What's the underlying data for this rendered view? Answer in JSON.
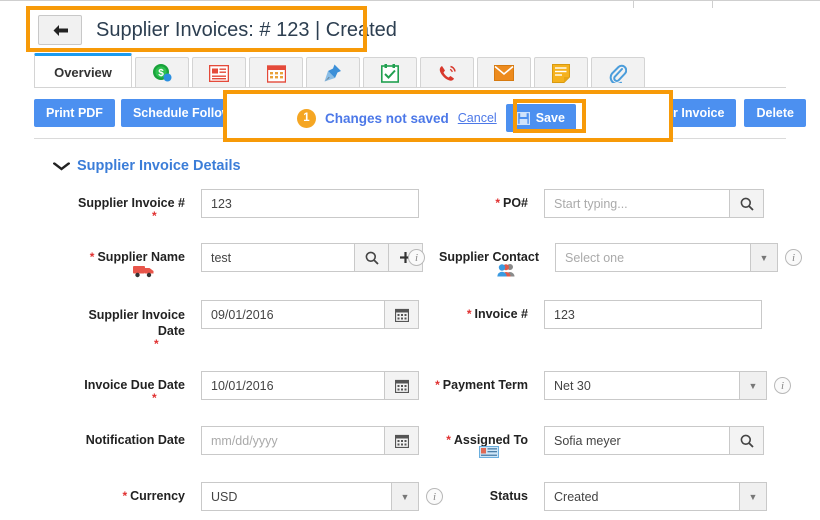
{
  "header": {
    "back_icon": "back-arrow-icon",
    "title": "Supplier Invoices: # 123 | Created"
  },
  "tabs": [
    {
      "label": "Overview",
      "icon": "overview-tab",
      "active": true
    },
    {
      "label": "",
      "icon": "money-dollar-icon",
      "active": false
    },
    {
      "label": "",
      "icon": "invoice-lines-icon",
      "active": false
    },
    {
      "label": "",
      "icon": "calendar-red-icon",
      "active": false
    },
    {
      "label": "",
      "icon": "pin-icon",
      "active": false
    },
    {
      "label": "",
      "icon": "task-check-icon",
      "active": false
    },
    {
      "label": "",
      "icon": "phone-call-icon",
      "active": false
    },
    {
      "label": "",
      "icon": "email-envelope-icon",
      "active": false
    },
    {
      "label": "",
      "icon": "notes-icon",
      "active": false
    },
    {
      "label": "",
      "icon": "attachment-paperclip-icon",
      "active": false
    }
  ],
  "toolbar": {
    "print_pdf": "Print PDF",
    "schedule_follow": "Schedule Follow",
    "invoice": "r Invoice",
    "delete": "Delete"
  },
  "unsaved": {
    "count": "1",
    "message": "Changes not saved",
    "cancel": "Cancel",
    "save": "Save",
    "save_icon": "floppy-disk-icon"
  },
  "section": {
    "title": "Supplier Invoice Details",
    "chevron": "chevron-down-icon"
  },
  "fields": {
    "supplier_invoice_no": {
      "label": "Supplier Invoice #",
      "value": "123"
    },
    "po_no": {
      "label": "PO#",
      "placeholder": "Start typing...",
      "value": ""
    },
    "supplier_name": {
      "label": "Supplier Name",
      "value": "test"
    },
    "supplier_contact": {
      "label": "Supplier Contact",
      "value": "",
      "placeholder": "Select one"
    },
    "supplier_invoice_date": {
      "label": "Supplier Invoice Date",
      "value": "09/01/2016"
    },
    "invoice_no": {
      "label": "Invoice #",
      "value": "123"
    },
    "invoice_due_date": {
      "label": "Invoice Due Date",
      "value": "10/01/2016"
    },
    "payment_term": {
      "label": "Payment Term",
      "value": "Net 30"
    },
    "notification_date": {
      "label": "Notification Date",
      "value": "",
      "placeholder": "mm/dd/yyyy"
    },
    "assigned_to": {
      "label": "Assigned To",
      "value": "Sofia meyer"
    },
    "currency": {
      "label": "Currency",
      "value": "USD"
    },
    "status": {
      "label": "Status",
      "value": "Created"
    }
  },
  "colors": {
    "accent_blue": "#4c90f0",
    "highlight_orange": "#f79a08",
    "link_blue": "#4c78e8",
    "required_red": "#e03030",
    "tab_active": "#1a9bf0"
  }
}
